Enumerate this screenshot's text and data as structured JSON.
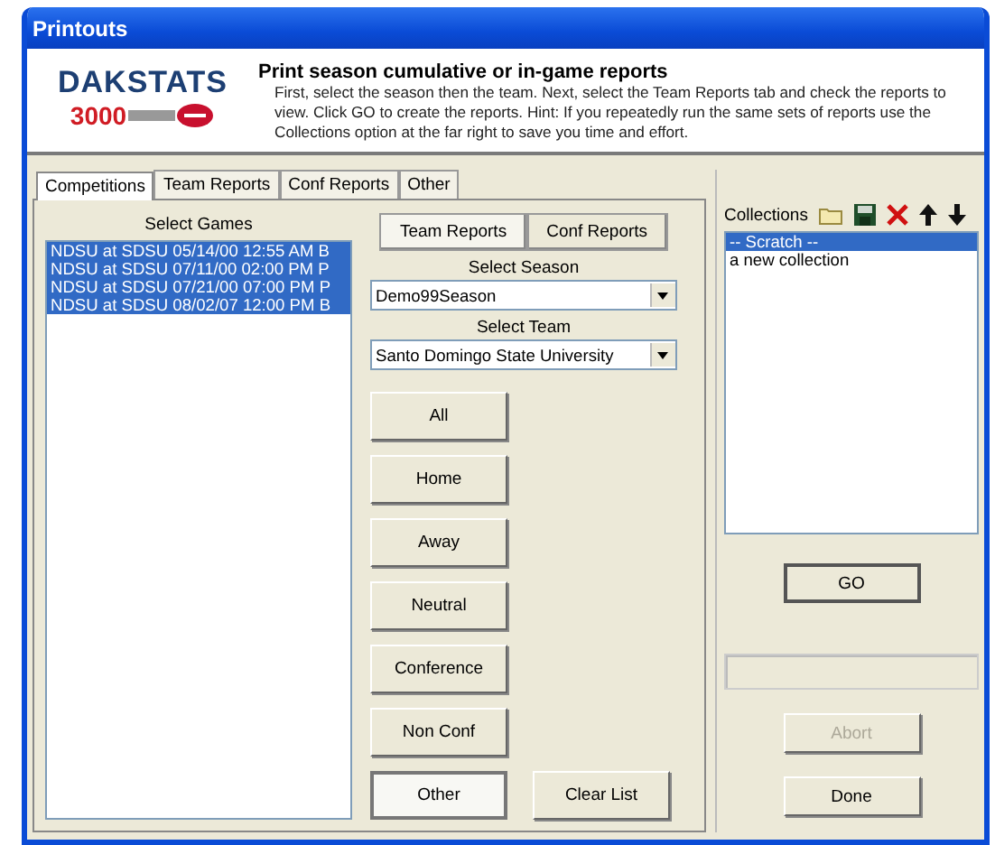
{
  "window": {
    "title": "Printouts"
  },
  "header": {
    "logo_name": "DAKSTATS",
    "logo_number": "3000",
    "heading": "Print season cumulative or in-game reports",
    "hint": "First, select the season then the team.  Next, select the Team Reports tab and check the reports to view. Click GO to create the reports.  Hint: If you repeatedly run the same sets of reports use the Collections option at the far right to save you time and effort."
  },
  "tabs": [
    {
      "label": "Competitions",
      "selected": true
    },
    {
      "label": "Team Reports",
      "selected": false
    },
    {
      "label": "Conf Reports",
      "selected": false
    },
    {
      "label": "Other",
      "selected": false
    }
  ],
  "games": {
    "label": "Select Games",
    "items": [
      {
        "text": "NDSU at SDSU 05/14/00 12:55 AM  B",
        "selected": true
      },
      {
        "text": "NDSU at SDSU 07/11/00 02:00 PM  P",
        "selected": true
      },
      {
        "text": "NDSU at SDSU 07/21/00 07:00 PM  P",
        "selected": true
      },
      {
        "text": "NDSU at SDSU 08/02/07 12:00 PM  B",
        "selected": true
      }
    ]
  },
  "report_tabs": [
    {
      "label": "Team Reports",
      "selected": true
    },
    {
      "label": "Conf Reports",
      "selected": false
    }
  ],
  "season": {
    "label": "Select Season",
    "value": "Demo99Season"
  },
  "team": {
    "label": "Select Team",
    "value": "Santo Domingo State University"
  },
  "filter_buttons": [
    {
      "label": "All",
      "pressed": false
    },
    {
      "label": "Home",
      "pressed": false
    },
    {
      "label": "Away",
      "pressed": false
    },
    {
      "label": "Neutral",
      "pressed": false
    },
    {
      "label": "Conference",
      "pressed": false
    },
    {
      "label": "Non Conf",
      "pressed": false
    },
    {
      "label": "Other",
      "pressed": true
    }
  ],
  "clear_button": "Clear List",
  "collections": {
    "label": "Collections",
    "items": [
      {
        "text": "-- Scratch --",
        "selected": true
      },
      {
        "text": "a new collection",
        "selected": false
      }
    ]
  },
  "go_button": "GO",
  "abort_button": {
    "label": "Abort",
    "disabled": true
  },
  "done_button": "Done"
}
